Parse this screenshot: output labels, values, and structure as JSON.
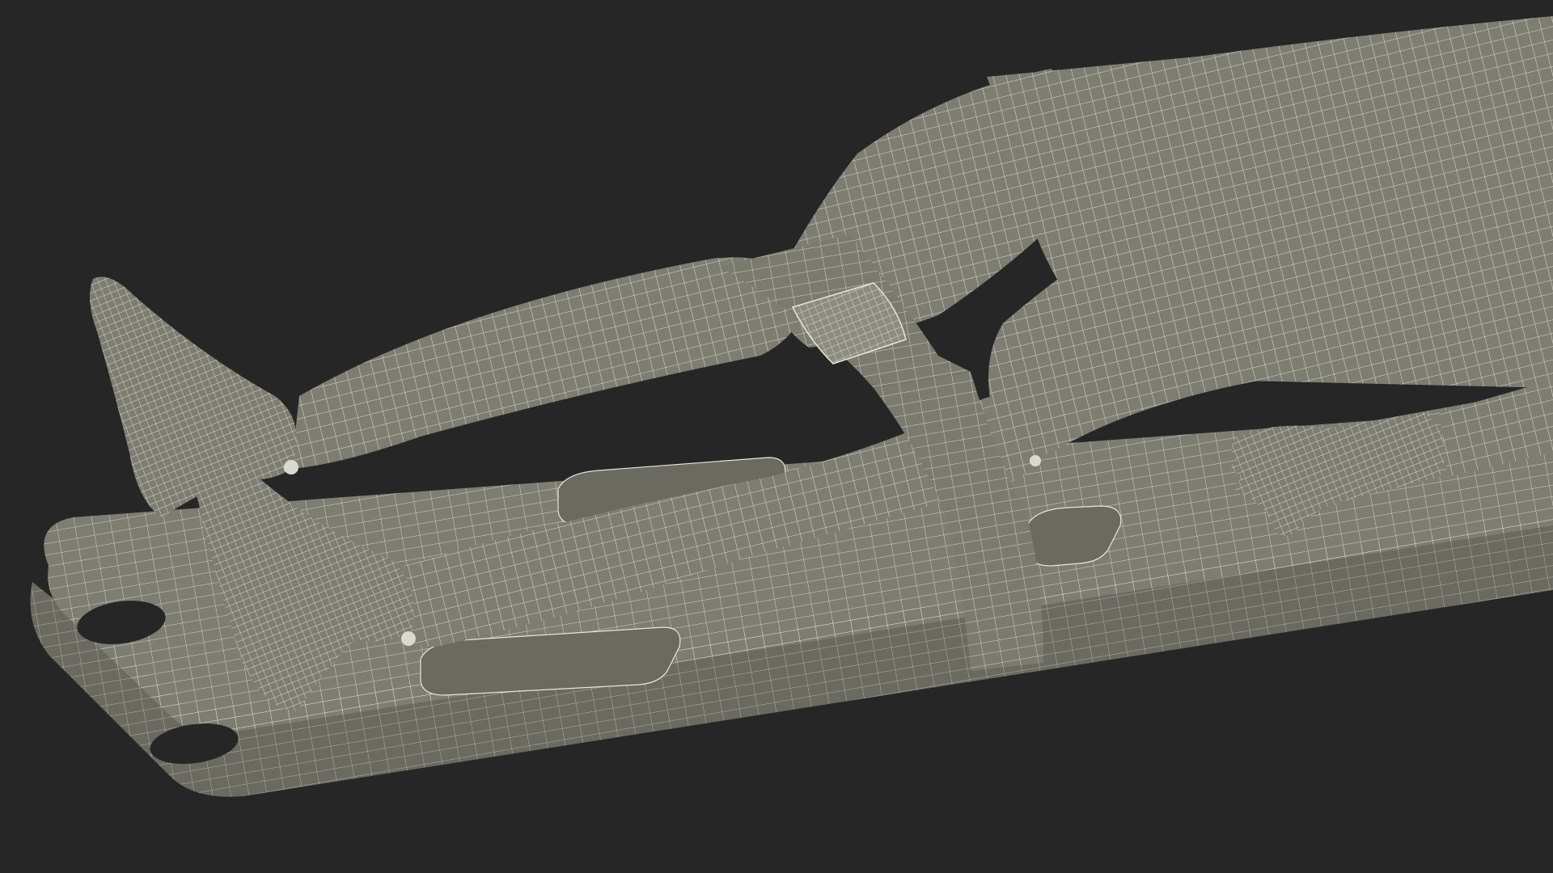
{
  "scene": {
    "subject": "wireframe-render",
    "colors": {
      "background": "#262626",
      "surface": "#7d7d72",
      "surface_dark": "#6a6a60",
      "surface_light": "#8c8c81",
      "wire": "#e6e6dc",
      "shadow": "#54544c"
    }
  }
}
